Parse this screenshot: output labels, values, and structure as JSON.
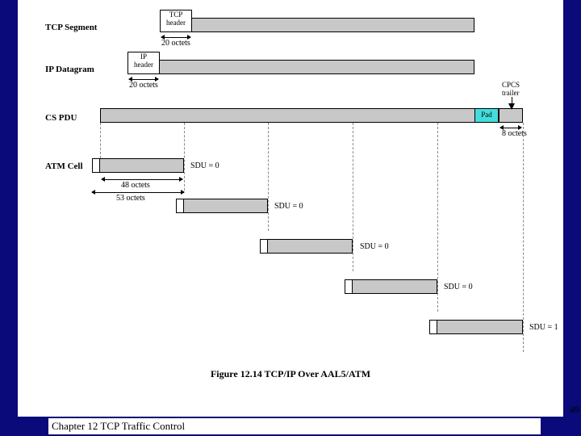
{
  "rows": {
    "tcp": {
      "label": "TCP Segment",
      "header_box": "TCP\nheader",
      "header_size": "20 octets"
    },
    "ip": {
      "label": "IP Datagram",
      "header_box": "IP\nheader",
      "header_size": "20 octets"
    },
    "cs": {
      "label": "CS PDU",
      "pad": "Pad",
      "trailer": "CPCS\ntrailer",
      "trailer_size": "8 octets"
    },
    "atm": {
      "label": "ATM Cell",
      "cell48": "48 octets",
      "cell53": "53 octets"
    }
  },
  "cells": [
    {
      "sdu": "SDU = 0"
    },
    {
      "sdu": "SDU = 0"
    },
    {
      "sdu": "SDU = 0"
    },
    {
      "sdu": "SDU = 0"
    },
    {
      "sdu": "SDU = 1"
    }
  ],
  "caption": "Figure 12.14   TCP/IP Over AAL5/ATM",
  "footer": "Chapter 12 TCP Traffic Control",
  "page": "49"
}
